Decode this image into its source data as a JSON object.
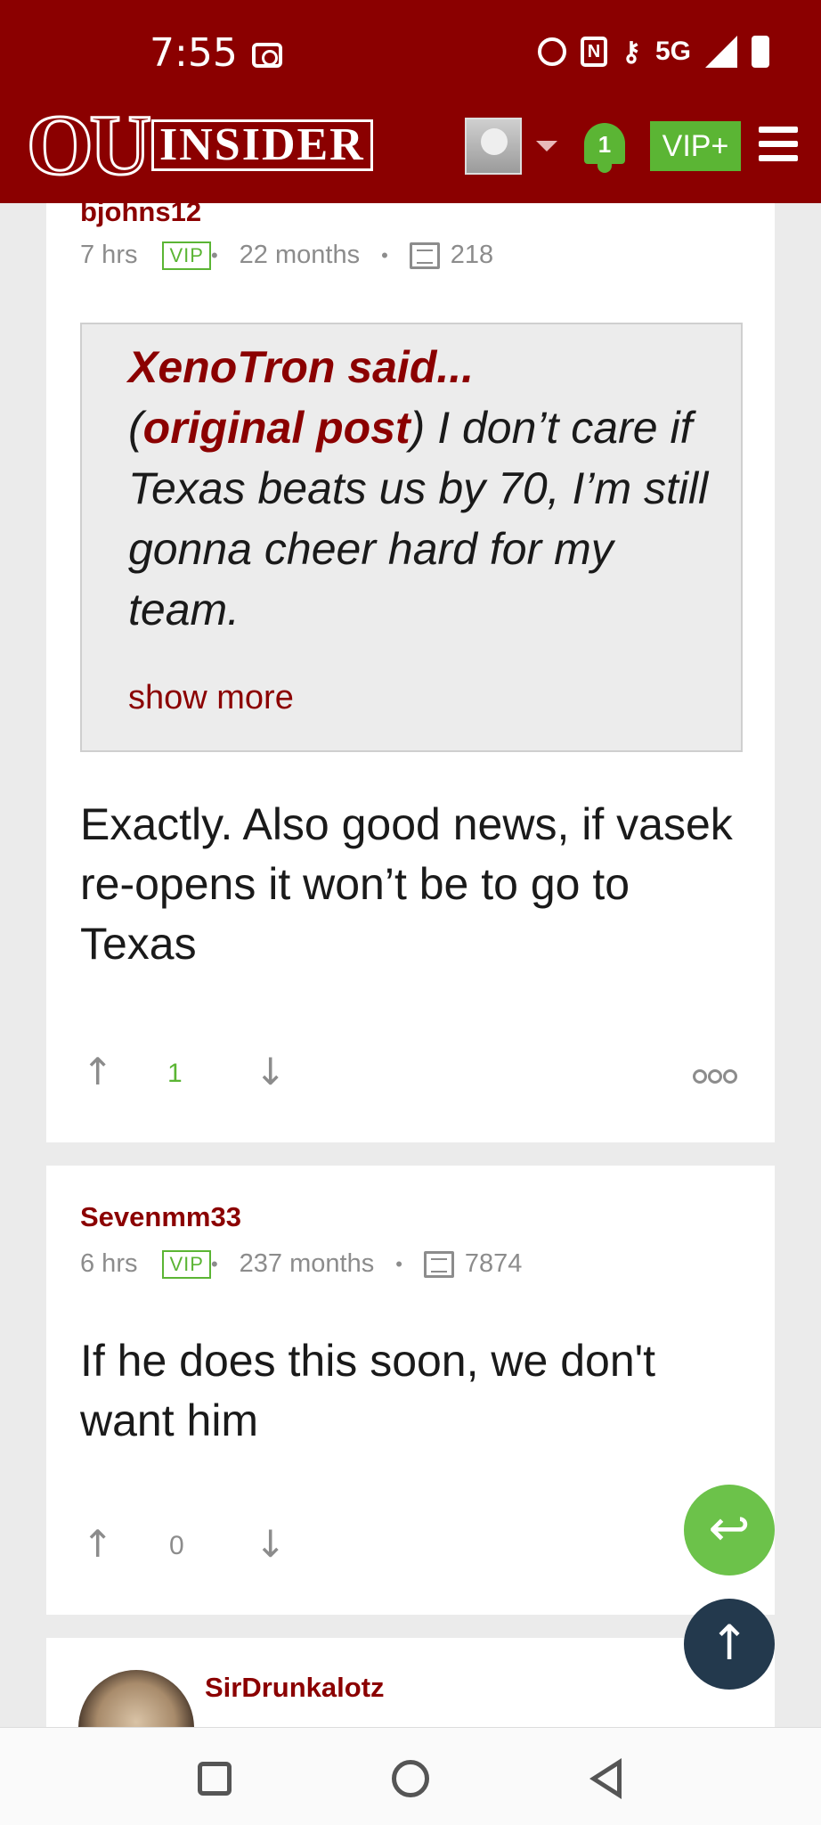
{
  "status_bar": {
    "time": "7:55",
    "network": "5G"
  },
  "header": {
    "logo_ou": "OU",
    "logo_insider": "INSIDER",
    "notifications_count": "1",
    "vip_label": "VIP+"
  },
  "posts": [
    {
      "username": "bjohns12",
      "time_ago": "7 hrs",
      "badge": "VIP",
      "membership": "22 months",
      "post_count": "218",
      "quote": {
        "author": "XenoTron said...",
        "open_paren": "(",
        "link_text": "original post",
        "close_paren": ")",
        "text": " I don’t care if Texas beats us by 70, I’m still gonna cheer hard for my team.",
        "show_more": "show more"
      },
      "body": "Exactly. Also good news, if vasek re-opens it won’t be to go to Texas",
      "votes": "1"
    },
    {
      "username": "Sevenmm33",
      "time_ago": "6 hrs",
      "badge": "VIP",
      "membership": "237 months",
      "post_count": "7874",
      "body": "If he does this soon, we don't want him",
      "votes": "0"
    },
    {
      "username": "SirDrunkalotz"
    }
  ],
  "icons": {
    "upvote": "↑",
    "downvote": "↓",
    "reply": "↩",
    "scroll_top": "↑"
  },
  "colors": {
    "brand": "#8b0000",
    "accent_green": "#5bb534",
    "fab_dark": "#23394d"
  }
}
